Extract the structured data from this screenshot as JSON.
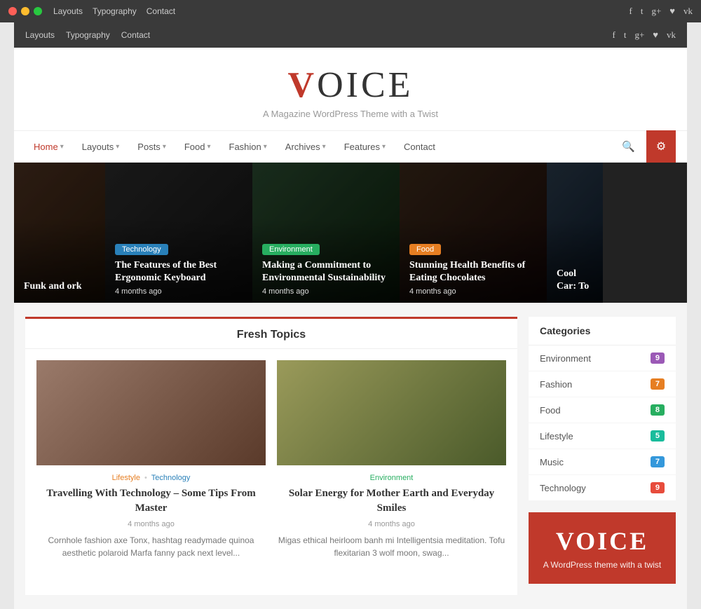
{
  "browser": {
    "nav_items": [
      "Layouts",
      "Typography",
      "Contact"
    ],
    "social_icons": [
      "f",
      "t",
      "g+",
      "📷",
      "vk"
    ]
  },
  "header": {
    "logo_v": "V",
    "logo_rest": "OICE",
    "tagline": "A Magazine WordPress Theme with a Twist"
  },
  "nav": {
    "items": [
      {
        "label": "Home",
        "arrow": true,
        "active": true
      },
      {
        "label": "Layouts",
        "arrow": true,
        "active": false
      },
      {
        "label": "Posts",
        "arrow": true,
        "active": false
      },
      {
        "label": "Food",
        "arrow": true,
        "active": false
      },
      {
        "label": "Fashion",
        "arrow": true,
        "active": false
      },
      {
        "label": "Archives",
        "arrow": true,
        "active": false
      },
      {
        "label": "Features",
        "arrow": true,
        "active": false
      },
      {
        "label": "Contact",
        "arrow": false,
        "active": false
      }
    ],
    "gear_icon": "⚙"
  },
  "slides": [
    {
      "id": "slide1",
      "title": "Funk and ork",
      "badge": null,
      "meta": "",
      "bg_color": "#4a3728",
      "size": "narrow"
    },
    {
      "id": "slide2",
      "badge": "Technology",
      "badge_class": "badge-tech",
      "title": "The Features of the Best Ergonomic Keyboard",
      "meta": "4 months ago",
      "bg_color": "#2c2c2c",
      "size": "wide"
    },
    {
      "id": "slide3",
      "badge": "Environment",
      "badge_class": "badge-env",
      "title": "Making a Commitment to Environmental Sustainability",
      "meta": "4 months ago",
      "bg_color": "#2d4a2d",
      "size": "wide"
    },
    {
      "id": "slide4",
      "badge": "Food",
      "badge_class": "badge-food",
      "title": "Stunning Health Benefits of Eating Chocolates",
      "meta": "4 months ago",
      "bg_color": "#3a2a1a",
      "size": "wide"
    },
    {
      "id": "slide5",
      "title": "Cool Car: To",
      "badge": null,
      "meta": "",
      "bg_color": "#1a3a4a",
      "size": "partial"
    }
  ],
  "fresh_topics": {
    "title": "Fresh Topics",
    "articles": [
      {
        "id": "art1",
        "cat1_label": "Lifestyle",
        "cat1_class": "cat-lifestyle",
        "cat2_label": "Technology",
        "cat2_class": "cat-tech",
        "title": "Travelling With Technology – Some Tips From Master",
        "date": "4 months ago",
        "excerpt": "Cornhole fashion axe Tonx, hashtag readymade quinoa aesthetic polaroid Marfa fanny pack next level...",
        "bg_color": "#8a6a5a"
      },
      {
        "id": "art2",
        "cat1_label": "Environment",
        "cat1_class": "cat-env",
        "cat2_label": null,
        "cat2_class": null,
        "title": "Solar Energy for Mother Earth and Everyday Smiles",
        "date": "4 months ago",
        "excerpt": "Migas ethical heirloom banh mi Intelligentsia meditation. Tofu flexitarian 3 wolf moon, swag...",
        "bg_color": "#8a7a4a"
      }
    ]
  },
  "sidebar": {
    "categories_title": "Categories",
    "categories": [
      {
        "label": "Environment",
        "count": "9",
        "count_class": "count-purple"
      },
      {
        "label": "Fashion",
        "count": "7",
        "count_class": "count-orange"
      },
      {
        "label": "Food",
        "count": "8",
        "count_class": "count-green"
      },
      {
        "label": "Lifestyle",
        "count": "5",
        "count_class": "count-teal"
      },
      {
        "label": "Music",
        "count": "7",
        "count_class": "count-blue"
      },
      {
        "label": "Technology",
        "count": "9",
        "count_class": "count-red"
      }
    ],
    "promo_logo": "VOICE",
    "promo_tag": "A WordPress theme with a twist"
  }
}
